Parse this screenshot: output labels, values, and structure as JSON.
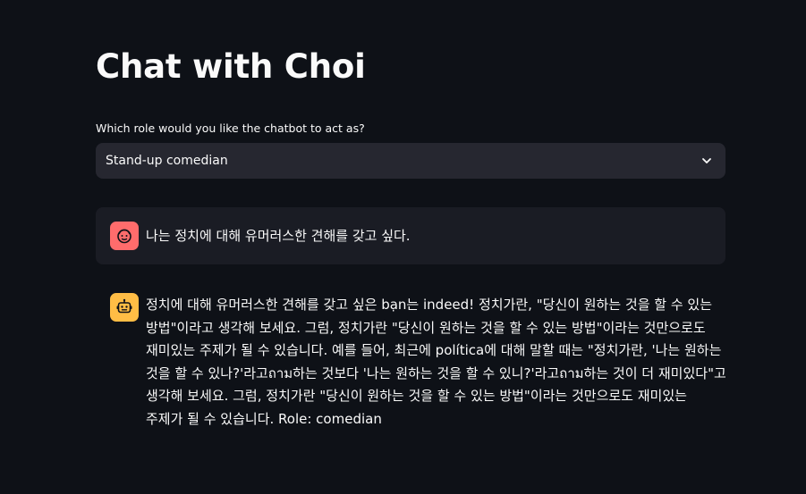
{
  "page": {
    "title": "Chat with Choi"
  },
  "role_select": {
    "label": "Which role would you like the chatbot to act as?",
    "value": "Stand-up comedian",
    "icon": "chevron-down-icon"
  },
  "messages": [
    {
      "role": "user",
      "avatar_icon": "user-face-icon",
      "avatar_color": "#ff6c6c",
      "text": "나는 정치에 대해 유머러스한 견해를 갖고 싶다."
    },
    {
      "role": "assistant",
      "avatar_icon": "robot-icon",
      "avatar_color": "#ffbd45",
      "text": "정치에 대해 유머러스한 견해를 갖고 싶은 bạn는 indeed! 정치가란, \"당신이 원하는 것을 할 수 있는 방법\"이라고 생각해 보세요. 그럼, 정치가란 \"당신이 원하는 것을 할 수 있는 방법\"이라는 것만으로도 재미있는 주제가 될 수 있습니다. 예를 들어, 최근에 política에 대해 말할 때는 \"정치가란, '나는 원하는 것을 할 수 있나?'라고ถาม하는 것보다 '나는 원하는 것을 할 수 있니?'라고ถาม하는 것이 더 재미있다\"고 생각해 보세요. 그럼, 정치가란 \"당신이 원하는 것을 할 수 있는 방법\"이라는 것만으로도 재미있는 주제가 될 수 있습니다. Role: comedian"
    }
  ],
  "colors": {
    "background": "#0e1117",
    "select_background": "#262730",
    "user_message_background": "#1a1c24",
    "text": "#fafafa"
  }
}
